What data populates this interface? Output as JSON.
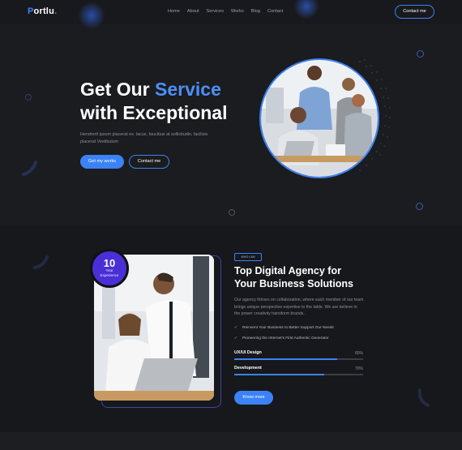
{
  "header": {
    "logo": "ortlu",
    "logo_initial": "P",
    "logo_dot": ".",
    "nav": [
      "Home",
      "About",
      "Services",
      "Works",
      "Blog",
      "Contact"
    ],
    "contact_button": "Contact me"
  },
  "hero": {
    "title_line1_a": "Get Our ",
    "title_line1_accent": "Service",
    "title_line2": "with Exceptional",
    "description": "Hendrerit ipsum placerat ex. lacus, faucibus at sollicitudin. facilisis placerat Vestibulum",
    "primary_button": "Get my works",
    "secondary_button": "Contact me"
  },
  "about": {
    "badge_number": "10",
    "badge_label_1": "Year",
    "badge_label_2": "Experience",
    "tag": "WHO I AM",
    "title_line1": "Top Digital Agency for",
    "title_line2": "Your Business Solutions",
    "body": "Our agency thrives on collaboration, where each member of our team brings unique perspective expertise to the table. We are believe in the power creativity transform brands.",
    "checks": [
      "Reinvent Your Business to Better Support Our Needs",
      "Pioneering the Internet's First Authentic Generator"
    ],
    "skills": [
      {
        "label": "UX/UI Design",
        "percent_text": "80%",
        "percent": 80
      },
      {
        "label": "Development",
        "percent_text": "70%",
        "percent": 70
      }
    ],
    "button": "Know more"
  },
  "colors": {
    "accent": "#3b82f6",
    "badge": "#4a2fd6",
    "background": "#17181b"
  }
}
